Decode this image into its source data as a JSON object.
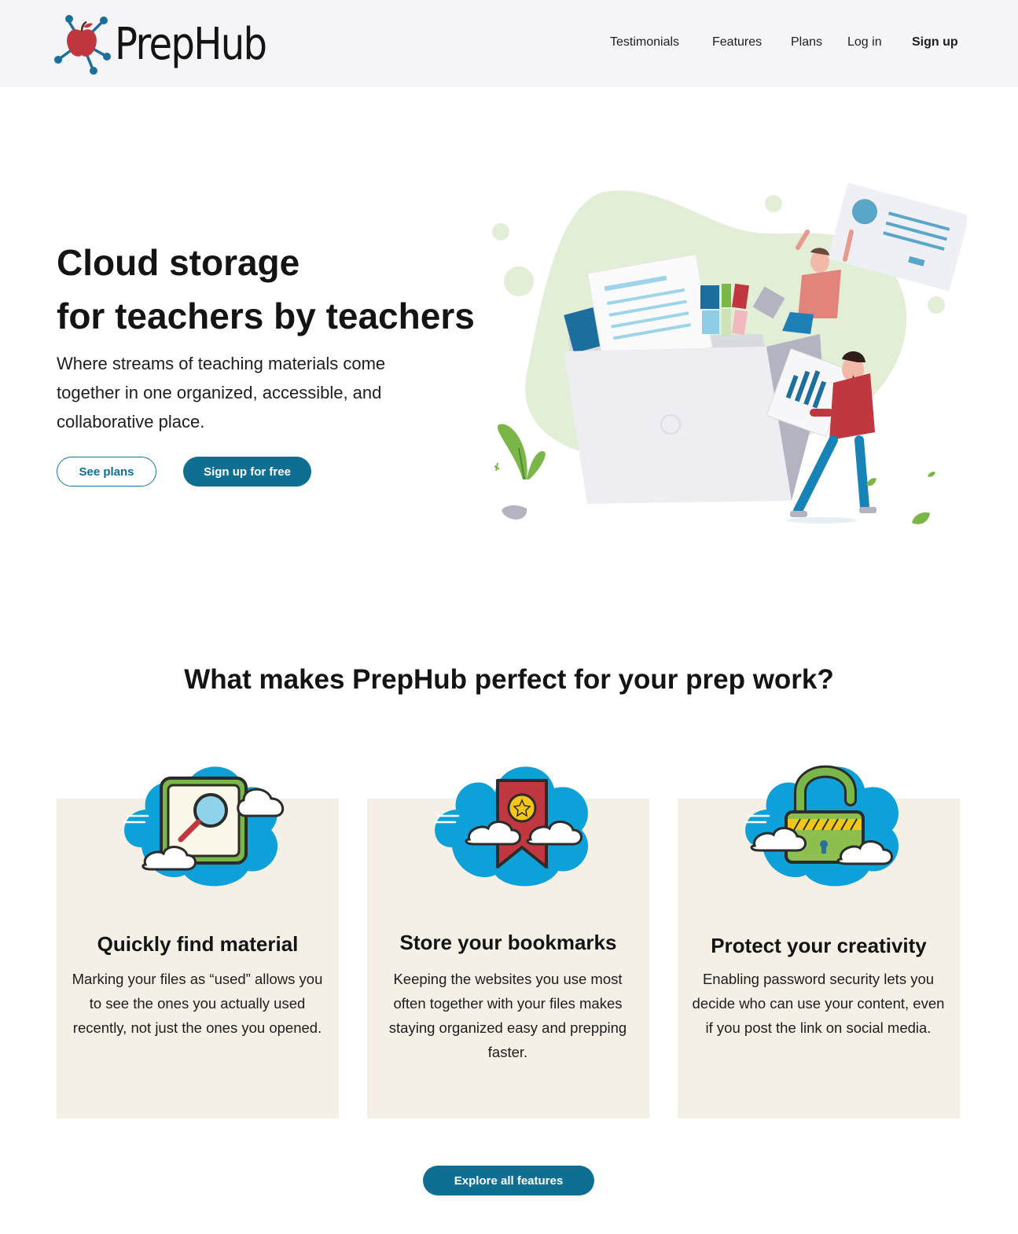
{
  "brand": {
    "name": "PrepHub",
    "accent": "#0e6f93",
    "logo_red": "#c0373f",
    "logo_blue": "#1c6f9c"
  },
  "nav": {
    "items": [
      {
        "label": "Testimonials"
      },
      {
        "label": "Features"
      },
      {
        "label": "Plans"
      },
      {
        "label": "Log in"
      },
      {
        "label": "Sign up"
      }
    ]
  },
  "hero": {
    "title_line1": "Cloud storage",
    "title_line2": "for teachers by teachers",
    "subtitle": "Where streams of teaching materials come together in one organized, accessible, and collaborative place.",
    "see_plans": "See plans",
    "signup_free": "Sign up for free",
    "illustration": "people-filing-documents-illustration"
  },
  "features": {
    "heading": "What makes PrepHub perfect for your prep work?",
    "cards": [
      {
        "icon": "magnifier-cloud-icon",
        "title": "Quickly find material",
        "text": "Marking your files as “used” allows you to see the ones you actually used recently, not just the ones you opened."
      },
      {
        "icon": "bookmark-cloud-icon",
        "title": "Store your bookmarks",
        "text": "Keeping the websites you use most often together with your files makes staying organized easy and prepping faster."
      },
      {
        "icon": "padlock-cloud-icon",
        "title": "Protect your creativity",
        "text": "Enabling password security lets you decide who can use your content, even if you post the link on social media."
      }
    ],
    "explore": "Explore all features"
  }
}
